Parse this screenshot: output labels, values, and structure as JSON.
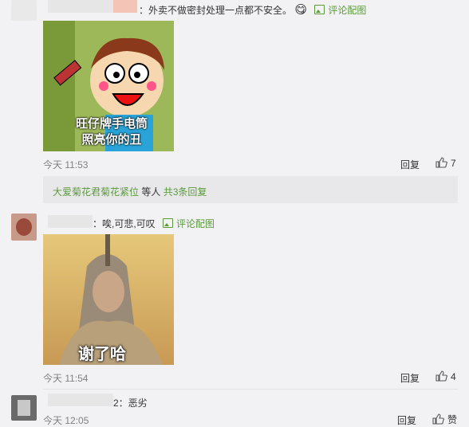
{
  "comments": [
    {
      "text": "：外卖不做密封处理一点都不安全。",
      "emoji": "😋",
      "image_link": "评论配图",
      "image_caption_lines": [
        "旺仔牌手电筒",
        "照亮你的丑"
      ],
      "time": "今天 11:53",
      "reply_label": "回复",
      "likes": "7"
    },
    {
      "text": "：唉,可悲,可叹",
      "image_link": "评论配图",
      "image_caption": "谢了哈",
      "time": "今天 11:54",
      "reply_label": "回复",
      "likes": "4"
    },
    {
      "text": "2：恶劣",
      "time": "今天 12:05",
      "reply_label": "回复",
      "likes": "赞"
    }
  ],
  "replies_summary": {
    "names": "大爱菊花君菊花紧位",
    "mid": "等人",
    "count": "共3条回复"
  }
}
